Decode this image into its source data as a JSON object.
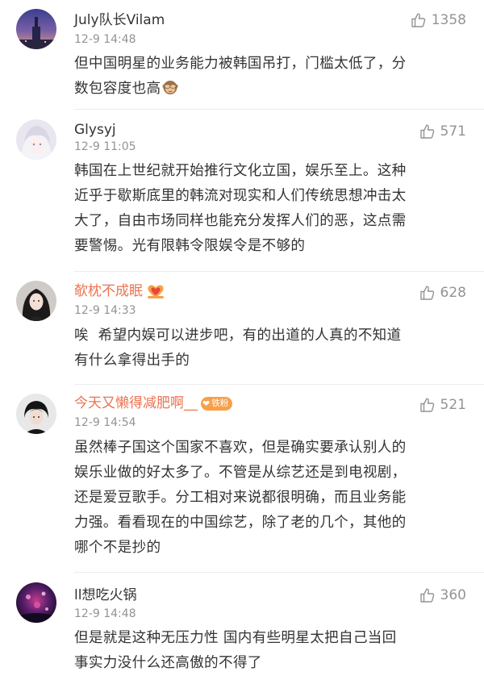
{
  "comments": [
    {
      "username": "July队长Vilam",
      "time": "12-9 14:48",
      "likes": "1358",
      "text_lines": [
        "但中国明星的业务能力被韩国吊打，门槛太低了，分",
        "数包容度也高"
      ],
      "emoji": "see-no-evil-monkey"
    },
    {
      "username": "Glysyj",
      "time": "12-9 11:05",
      "likes": "571",
      "text_lines": [
        "韩国在上世纪就开始推行文化立国，娱乐至上。这种",
        "近乎于歇斯底里的韩流对现实和人们传统思想冲击太",
        "大了，自由市场同样也能充分发挥人们的恶，这点需",
        "要警惕。光有限韩令限娱令是不够的"
      ]
    },
    {
      "username": "欹枕不成眠",
      "time": "12-9 14:33",
      "likes": "628",
      "text_lines": [
        "唉  希望内娱可以进步吧，有的出道的人真的不知道",
        "有什么拿得出手的"
      ],
      "badge": "heart-badge"
    },
    {
      "username": "今天又懒得减肥啊__",
      "time": "12-9 14:54",
      "likes": "521",
      "text_lines": [
        "虽然棒子国这个国家不喜欢，但是确实要承认别人的",
        "娱乐业做的好太多了。不管是从综艺还是到电视剧，",
        "还是爱豆歌手。分工相对来说都很明确，而且业务能",
        "力强。看看现在的中国综艺，除了老的几个，其他的",
        "哪个不是抄的"
      ],
      "fan_badge": "铁粉"
    },
    {
      "username": "ll想吃火锅",
      "time": "12-9 14:48",
      "likes": "360",
      "text_lines": [
        "但是就是这种无压力性 国内有些明星太把自己当回",
        "事实力没什么还高傲的不得了"
      ]
    }
  ],
  "colors": {
    "vip_name": "#eb7350",
    "normal_name": "#333333",
    "meta": "#939393"
  }
}
